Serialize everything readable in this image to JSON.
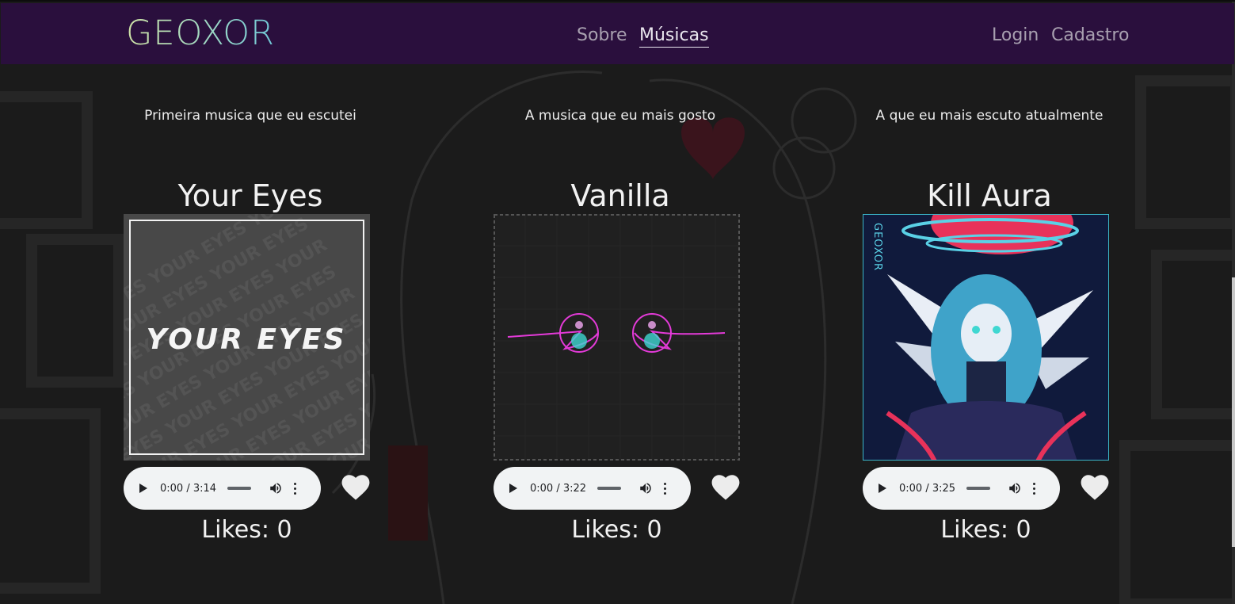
{
  "nav": {
    "logo": "GEOXOR",
    "links": [
      "Sobre",
      "Músicas"
    ],
    "auth": [
      "Login",
      "Cadastro"
    ]
  },
  "songs": [
    {
      "caption": "Primeira musica que eu escutei",
      "title": "Your Eyes",
      "cover_text": "YOUR EYES",
      "time": "0:00 / 3:14",
      "likes": "Likes: 0"
    },
    {
      "caption": "A musica que eu mais gosto",
      "title": "Vanilla",
      "time": "0:00 / 3:22",
      "likes": "Likes: 0"
    },
    {
      "caption": "A que eu mais escuto atualmente",
      "title": "Kill Aura",
      "cover_text": "GEOXOR",
      "time": "0:00 / 3:25",
      "likes": "Likes: 0"
    }
  ],
  "colors": {
    "navbar": "#2a0f3d",
    "page": "#1a1a1a",
    "player": "#f1f3f4"
  }
}
